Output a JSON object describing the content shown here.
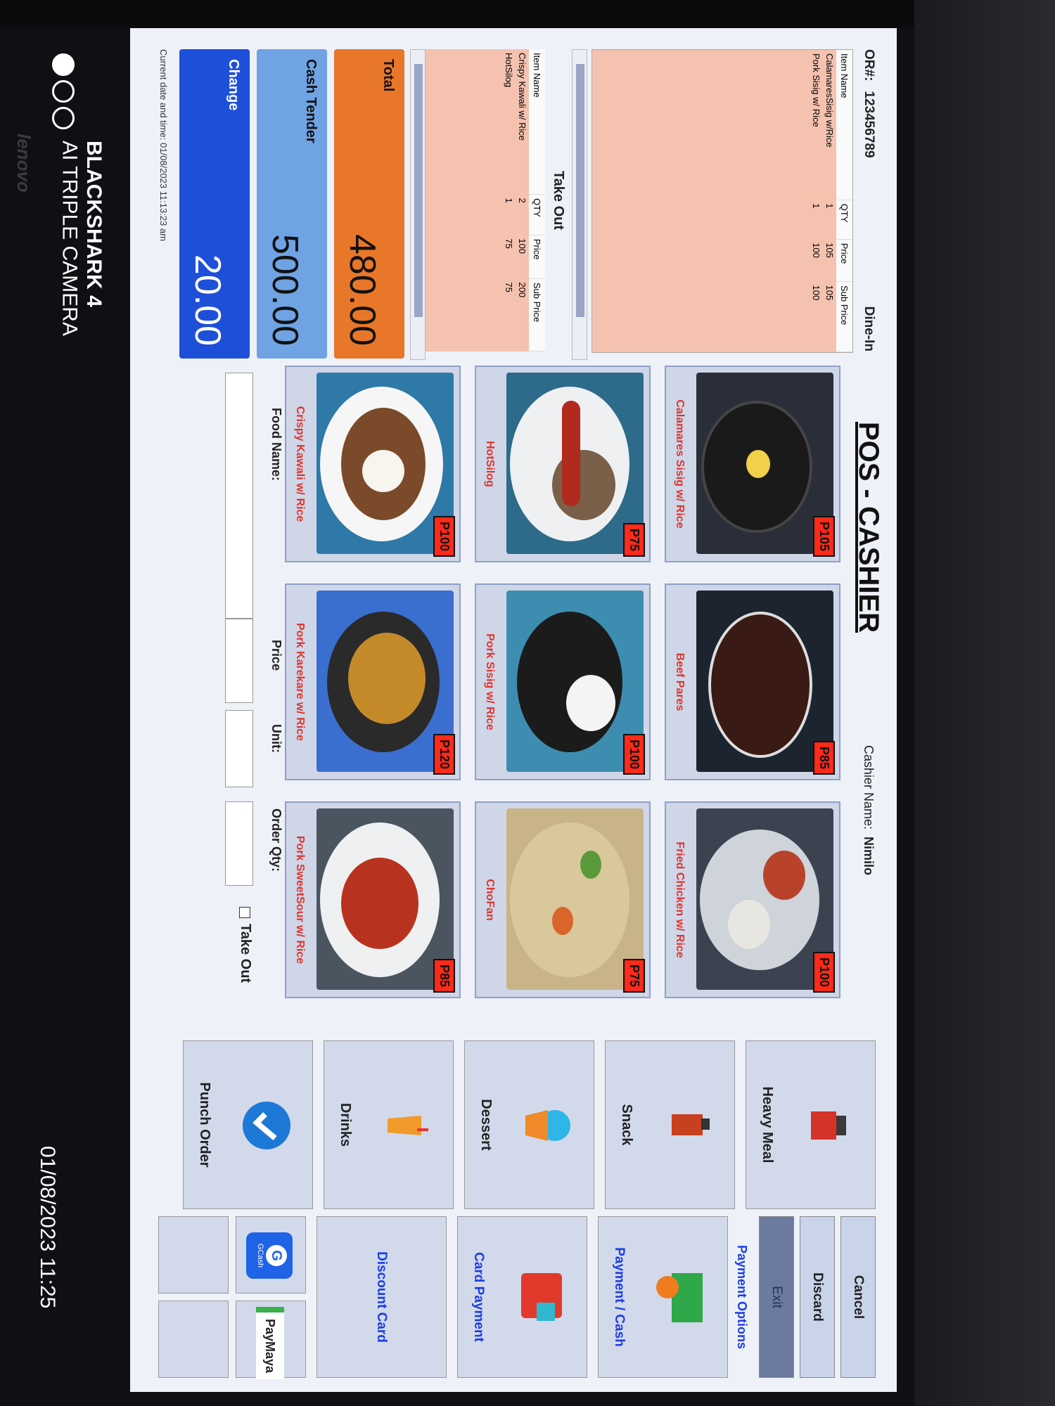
{
  "photo": {
    "watermark_brand": "BLACKSHARK 4",
    "watermark_camera": "AI TRIPLE CAMERA",
    "watermark_datetime": "01/08/2023 11:25",
    "bezel_brand": "lenovo"
  },
  "header": {
    "or_label": "OR#:",
    "or_number": "123456789",
    "mode": "Dine-In",
    "title": "POS - CASHIER",
    "cashier_label": "Cashier Name:",
    "cashier_name": "Nimilo"
  },
  "dine_in": {
    "columns": [
      "Item Name",
      "QTY",
      "Price",
      "Sub Price"
    ],
    "rows": [
      [
        "CalamaresSisig w/Rice",
        "1",
        "105",
        "105"
      ],
      [
        "Pork Sisig w/ Rice",
        "1",
        "100",
        "100"
      ]
    ]
  },
  "take_out": {
    "title": "Take Out",
    "columns": [
      "Item Name",
      "QTY",
      "Price",
      "Sub Price"
    ],
    "rows": [
      [
        "Crispy Kawali w/ Rice",
        "2",
        "100",
        "200"
      ],
      [
        "HotSilog",
        "1",
        "75",
        "75"
      ]
    ]
  },
  "totals": {
    "total_label": "Total",
    "total_value": "480.00",
    "tender_label": "Cash Tender",
    "tender_value": "500.00",
    "change_label": "Change",
    "change_value": "20.00"
  },
  "datetime_text": "Current date and time: 01/08/2023 11:13:23 am",
  "menu": [
    {
      "name": "Calamares Sisig w/ Rice",
      "price": "P105"
    },
    {
      "name": "Beef Pares",
      "price": "P85"
    },
    {
      "name": "Fried Chicken w/ Rice",
      "price": "P100"
    },
    {
      "name": "HotSilog",
      "price": "P75"
    },
    {
      "name": "Pork Sisig w/ Rice",
      "price": "P100"
    },
    {
      "name": "ChoFan",
      "price": "P75"
    },
    {
      "name": "Crispy Kawali w/ Rice",
      "price": "P100"
    },
    {
      "name": "Pork Karekare w/ Rice",
      "price": "P120"
    },
    {
      "name": "Pork SweetSour w/ Rice",
      "price": "P85"
    }
  ],
  "form": {
    "food_name_label": "Food Name:",
    "price_label": "Price",
    "unit_label": "Unit:",
    "order_qty_label": "Order Qty:",
    "take_out_label": "Take Out"
  },
  "categories": [
    "Heavy Meal",
    "Snack",
    "Dessert",
    "Drinks",
    "Punch Order"
  ],
  "actions": {
    "cancel": "Cancel",
    "discard": "Discard",
    "exit": "Exit"
  },
  "payment": {
    "title": "Payment Options",
    "cash": "Payment / Cash",
    "card": "Card Payment",
    "discount": "Discount Card",
    "gcash": "GCash",
    "paymaya": "PayMaya"
  },
  "colors": {
    "total": "#e8772a",
    "tender": "#6fa3e3",
    "change": "#1e4fd8",
    "cart_bg": "#f5c2b0",
    "price_tag": "#ff2a1a",
    "payment_accent": "#1a3de6"
  }
}
